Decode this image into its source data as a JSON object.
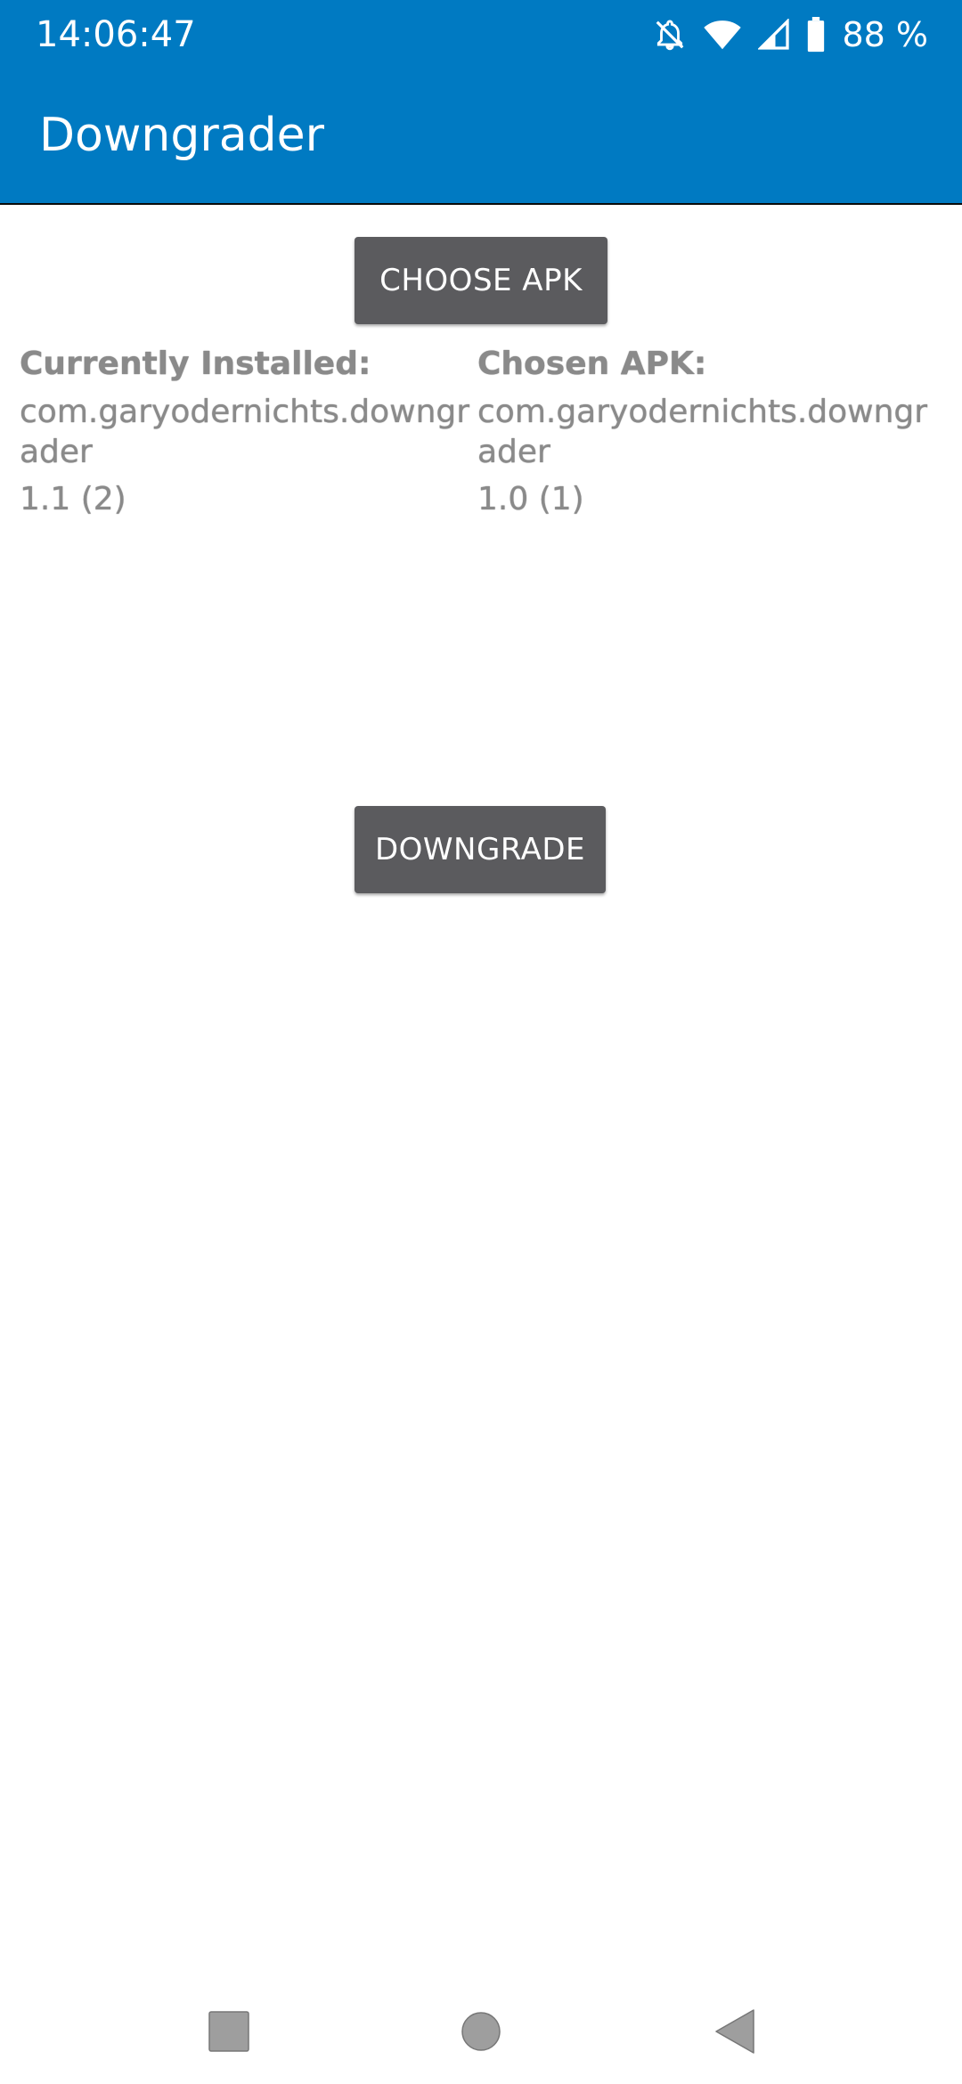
{
  "status_bar": {
    "time": "14:06:47",
    "battery": "88 %",
    "icons": [
      "notifications-off-icon",
      "wifi-icon",
      "signal-icon",
      "battery-icon"
    ],
    "background": "#007AC2"
  },
  "app_bar": {
    "title": "Downgrader",
    "background": "#007AC2"
  },
  "buttons": {
    "choose_apk": "CHOOSE APK",
    "downgrade": "DOWNGRADE",
    "background": "#5B5B5E"
  },
  "installed": {
    "heading": "Currently Installed:",
    "package": "com.garyodernichts.downgrader",
    "version": "1.1 (2)"
  },
  "chosen": {
    "heading": "Chosen APK:",
    "package": "com.garyodernichts.downgrader",
    "version": "1.0 (1)"
  },
  "nav_bar": {
    "icons": [
      "recents-square-icon",
      "home-circle-icon",
      "back-triangle-icon"
    ]
  }
}
